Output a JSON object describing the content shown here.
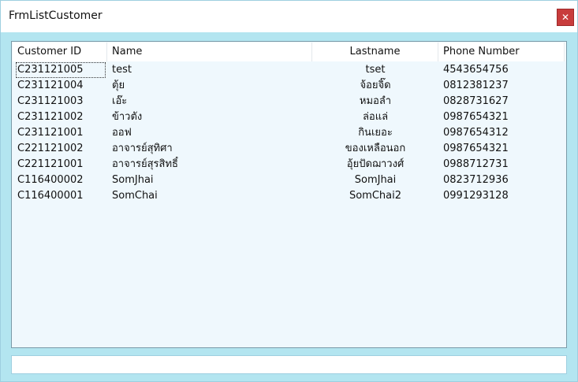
{
  "window": {
    "title": "FrmListCustomer",
    "close_glyph": "✕",
    "accent_color": "#b3e5f0",
    "close_color": "#c83c3c"
  },
  "listview": {
    "columns": [
      "Customer ID",
      "Name",
      "Lastname",
      "Phone Number"
    ],
    "rows": [
      {
        "id": "C231121005",
        "name": "test",
        "lastname": "tset",
        "phone": "4543654756"
      },
      {
        "id": "C231121004",
        "name": "ตุ้ย",
        "lastname": "จ้อยจิ๊ด",
        "phone": "0812381237"
      },
      {
        "id": "C231121003",
        "name": "เอ๊ะ",
        "lastname": "หมอลำ",
        "phone": "0828731627"
      },
      {
        "id": "C231121002",
        "name": "ข้าวตัง",
        "lastname": "ล่อแล่",
        "phone": "0987654321"
      },
      {
        "id": "C231121001",
        "name": "ออฟ",
        "lastname": "กินเยอะ",
        "phone": "0987654312"
      },
      {
        "id": "C221121002",
        "name": "อาจารย์สุทิศา",
        "lastname": "ของเหลือนอก",
        "phone": "0987654321"
      },
      {
        "id": "C221121001",
        "name": "อาจารย์สุรสิทธิ์",
        "lastname": "อุ้ยปัดฌาวงศ์",
        "phone": "0988712731"
      },
      {
        "id": "C116400002",
        "name": "SomJhai",
        "lastname": "SomJhai",
        "phone": "0823712936"
      },
      {
        "id": "C116400001",
        "name": "SomChai",
        "lastname": "SomChai2",
        "phone": "0991293128"
      }
    ]
  },
  "statusbar": {
    "text": ""
  }
}
